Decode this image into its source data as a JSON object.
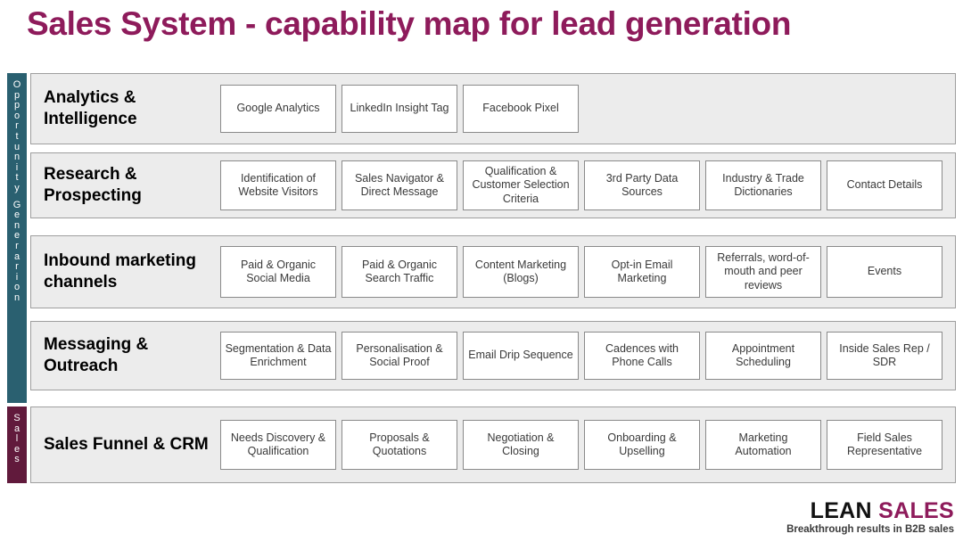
{
  "slide": {
    "title": "Sales System - capability map for lead generation",
    "colors": {
      "title": "#8e1b5b",
      "band_opportunity": "#2a6070",
      "band_sales": "#611a3c",
      "row_background": "#ececec",
      "box_background": "#ffffff",
      "box_border": "#8a8a8a"
    }
  },
  "phases": [
    {
      "id": "opportunity",
      "label": "Opportunity Generarion"
    },
    {
      "id": "sales",
      "label": "Sales"
    }
  ],
  "rows": [
    {
      "id": "analytics",
      "label": "Analytics & Intelligence",
      "phase": "opportunity",
      "boxes": [
        "Google Analytics",
        "LinkedIn Insight Tag",
        "Facebook Pixel"
      ]
    },
    {
      "id": "research",
      "label": "Research & Prospecting",
      "phase": "opportunity",
      "boxes": [
        "Identification of Website Visitors",
        "Sales Navigator & Direct Message",
        "Qualification & Customer Selection Criteria",
        "3rd Party Data Sources",
        "Industry & Trade Dictionaries",
        "Contact Details"
      ]
    },
    {
      "id": "inbound",
      "label": "Inbound marketing channels",
      "phase": "opportunity",
      "boxes": [
        "Paid & Organic Social Media",
        "Paid & Organic Search Traffic",
        "Content Marketing (Blogs)",
        "Opt-in Email Marketing",
        "Referrals, word-of-mouth and peer reviews",
        "Events"
      ]
    },
    {
      "id": "messaging",
      "label": "Messaging & Outreach",
      "phase": "opportunity",
      "boxes": [
        "Segmentation & Data Enrichment",
        "Personalisation & Social Proof",
        "Email Drip Sequence",
        "Cadences with Phone Calls",
        "Appointment Scheduling",
        "Inside Sales Rep / SDR"
      ]
    },
    {
      "id": "salesfunnel",
      "label": "Sales Funnel & CRM",
      "phase": "sales",
      "boxes": [
        "Needs Discovery & Qualification",
        "Proposals & Quotations",
        "Negotiation & Closing",
        "Onboarding & Upselling",
        "Marketing Automation",
        "Field Sales Representative"
      ]
    }
  ],
  "footer": {
    "logo_primary": "LEAN",
    "logo_secondary": "SALES",
    "tagline": "Breakthrough results in B2B sales"
  }
}
